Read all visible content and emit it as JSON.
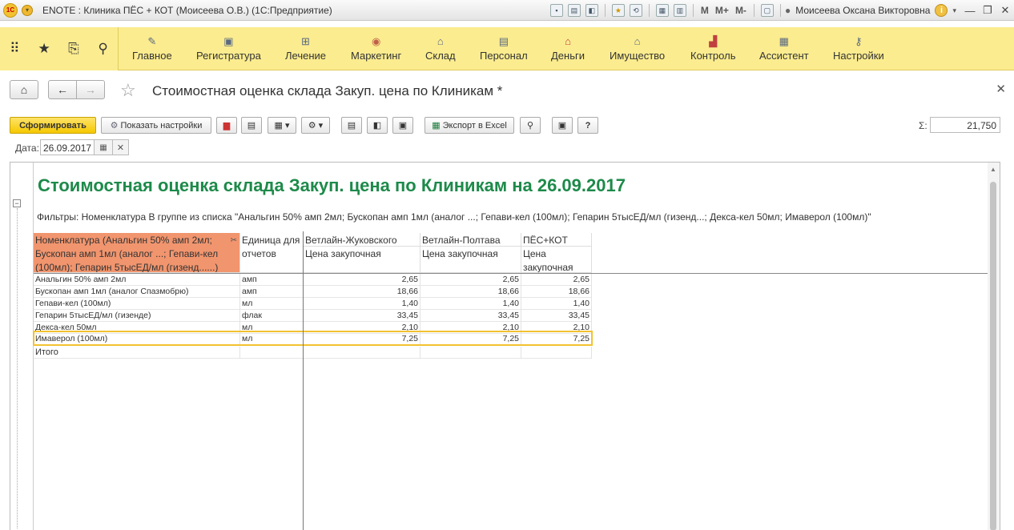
{
  "titlebar": {
    "app_title": "ENOTE : Клиника ПЁС + КОТ (Моисеева О.В.)  (1С:Предприятие)",
    "m_label": "M",
    "mplus_label": "M+",
    "mminus_label": "M-",
    "user": "Моисеева Оксана Викторовна"
  },
  "sections": [
    {
      "label": "Главное",
      "icon": "paperclip-icon"
    },
    {
      "label": "Регистратура",
      "icon": "registry-icon"
    },
    {
      "label": "Лечение",
      "icon": "treatment-icon"
    },
    {
      "label": "Маркетинг",
      "icon": "marketing-icon"
    },
    {
      "label": "Склад",
      "icon": "warehouse-icon"
    },
    {
      "label": "Персонал",
      "icon": "staff-icon"
    },
    {
      "label": "Деньги",
      "icon": "money-icon"
    },
    {
      "label": "Имущество",
      "icon": "property-icon"
    },
    {
      "label": "Контроль",
      "icon": "chart-icon"
    },
    {
      "label": "Ассистент",
      "icon": "assistant-icon"
    },
    {
      "label": "Настройки",
      "icon": "wrench-icon"
    }
  ],
  "form": {
    "title": "Стоимостная оценка склада Закуп. цена по Клиникам *"
  },
  "toolbar": {
    "generate": "Сформировать",
    "show_settings": "Показать настройки",
    "export_excel": "Экспорт в Excel",
    "help": "?",
    "sum_label": "Σ:",
    "sum_value": "21,750"
  },
  "date": {
    "label": "Дата:",
    "value": "26.09.2017"
  },
  "report": {
    "title": "Стоимостная оценка склада Закуп. цена по Клиникам на 26.09.2017",
    "filter": "Фильтры: Номенклатура В группе из списка \"Анальгин 50% амп 2мл; Бускопан амп 1мл (аналог ...; Гепави-кел (100мл); Гепарин 5тысЕД/мл (гизенд...; Декса-кел 50мл; Имаверол (100мл)\"",
    "header_nomenclature": "Номенклатура (Анальгин 50% амп 2мл; Бускопан амп 1мл (аналог ...; Гепави-кел (100мл); Гепарин 5тысЕД/мл (гизенд......)",
    "header_unit": "Единица для отчетов",
    "clinics": [
      "Ветлайн-Жуковского",
      "Ветлайн-Полтава",
      "ПЁС+КОТ"
    ],
    "price_label": "Цена закупочная",
    "rows": [
      {
        "name": "Анальгин 50% амп 2мл",
        "unit": "амп",
        "v1": "2,65",
        "v2": "2,65",
        "v3": "2,65"
      },
      {
        "name": "Бускопан амп 1мл (аналог Спазмобрю)",
        "unit": "амп",
        "v1": "18,66",
        "v2": "18,66",
        "v3": "18,66"
      },
      {
        "name": "Гепави-кел (100мл)",
        "unit": "мл",
        "v1": "1,40",
        "v2": "1,40",
        "v3": "1,40"
      },
      {
        "name": "Гепарин 5тысЕД/мл (гизенде)",
        "unit": "флак",
        "v1": "33,45",
        "v2": "33,45",
        "v3": "33,45"
      },
      {
        "name": "Декса-кел 50мл",
        "unit": "мл",
        "v1": "2,10",
        "v2": "2,10",
        "v3": "2,10"
      },
      {
        "name": "Имаверол (100мл)",
        "unit": "мл",
        "v1": "7,25",
        "v2": "7,25",
        "v3": "7,25"
      }
    ],
    "total": "Итого"
  }
}
